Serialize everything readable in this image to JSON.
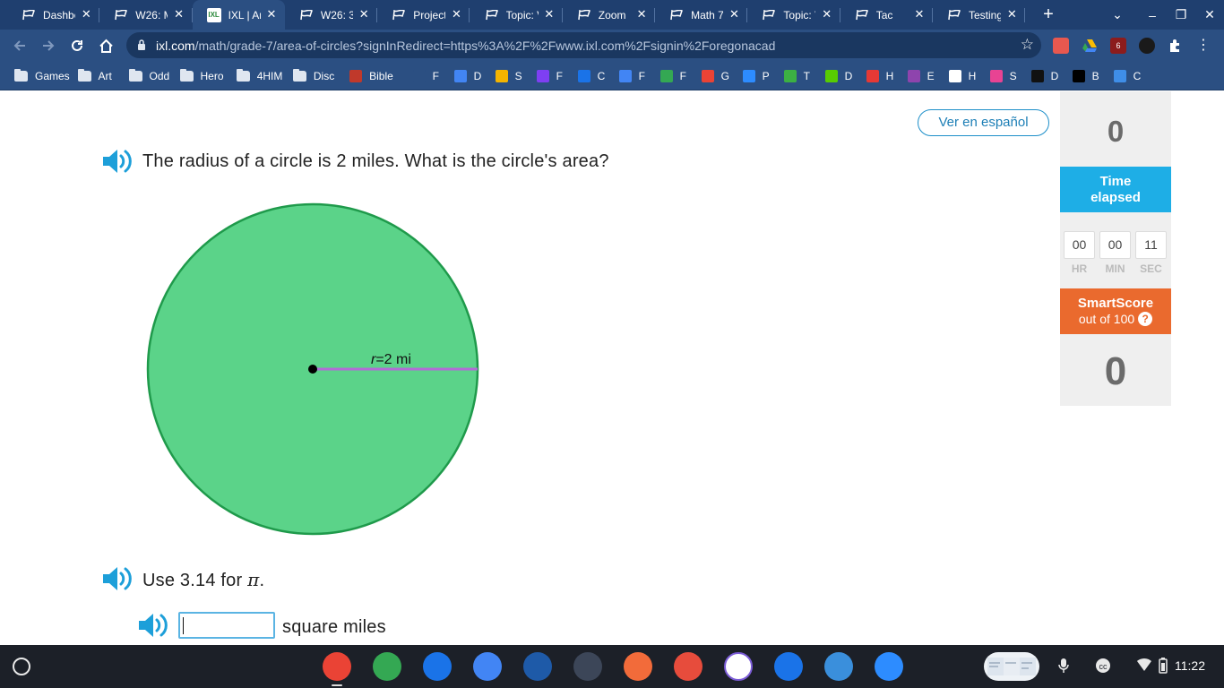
{
  "tabs": [
    {
      "title": "Dashbo",
      "active": false
    },
    {
      "title": "W26: M",
      "active": false
    },
    {
      "title": "IXL | Ar",
      "active": true
    },
    {
      "title": "W26: 3.",
      "active": false
    },
    {
      "title": "Project",
      "active": false
    },
    {
      "title": "Topic: V",
      "active": false
    },
    {
      "title": "Zoom",
      "active": false
    },
    {
      "title": "Math 7",
      "active": false
    },
    {
      "title": "Topic: V",
      "active": false
    },
    {
      "title": "Tac",
      "active": false
    },
    {
      "title": "Testing",
      "active": false
    }
  ],
  "tab_favicon_text": "IXL",
  "new_tab_label": "+",
  "window_controls": {
    "dropdown": "⌄",
    "minimize": "–",
    "restore": "❐",
    "close": "✕"
  },
  "address": {
    "host": "ixl.com",
    "path": "/math/grade-7/area-of-circles?signInRedirect=https%3A%2F%2Fwww.ixl.com%2Fsignin%2Foregonacad"
  },
  "extensions_badge": "6",
  "bookmarks": [
    {
      "label": "Games",
      "type": "folder"
    },
    {
      "label": "Art",
      "type": "folder"
    },
    {
      "label": "Odd",
      "type": "folder"
    },
    {
      "label": "Hero",
      "type": "folder"
    },
    {
      "label": "4HIM",
      "type": "folder"
    },
    {
      "label": "Disc",
      "type": "folder"
    },
    {
      "label": "Bible",
      "type": "link",
      "color": "#c0392b"
    },
    {
      "label": "F",
      "type": "link",
      "color": "#2b4f82",
      "glyph": "✝"
    },
    {
      "label": "D",
      "type": "link",
      "color": "#4285f4"
    },
    {
      "label": "S",
      "type": "link",
      "color": "#f4b400"
    },
    {
      "label": "F",
      "type": "link",
      "color": "#7e3ff2"
    },
    {
      "label": "C",
      "type": "link",
      "color": "#1a73e8"
    },
    {
      "label": "F",
      "type": "link",
      "color": "#4285f4"
    },
    {
      "label": "F",
      "type": "link",
      "color": "#34a853"
    },
    {
      "label": "G",
      "type": "link",
      "color": "#ea4335"
    },
    {
      "label": "P",
      "type": "link",
      "color": "#2d8cff"
    },
    {
      "label": "T",
      "type": "link",
      "color": "#3cb043"
    },
    {
      "label": "D",
      "type": "link",
      "color": "#58cc02"
    },
    {
      "label": "H",
      "type": "link",
      "color": "#e53935"
    },
    {
      "label": "E",
      "type": "link",
      "color": "#8e44ad"
    },
    {
      "label": "H",
      "type": "link",
      "color": "#ffffff"
    },
    {
      "label": "S",
      "type": "link",
      "color": "#e84393"
    },
    {
      "label": "D",
      "type": "link",
      "color": "#111111"
    },
    {
      "label": "B",
      "type": "link",
      "color": "#000000"
    },
    {
      "label": "C",
      "type": "link",
      "color": "#3f8ee8"
    }
  ],
  "page": {
    "spanish_button": "Ver en español",
    "question": "The radius of a circle is 2 miles. What is the circle's area?",
    "figure": {
      "radius_var": "r",
      "radius_value": "=2 mi",
      "fill": "#5bd389",
      "stroke": "#1f9a4b",
      "radius_color": "#b36bd6"
    },
    "pi_hint_prefix": "Use 3.14 for ",
    "pi_symbol": "π",
    "pi_hint_suffix": ".",
    "answer_value": "",
    "answer_unit": "square miles"
  },
  "sidebar": {
    "questions_answered": "0",
    "time_elapsed_label_1": "Time",
    "time_elapsed_label_2": "elapsed",
    "timer": {
      "hr": "00",
      "min": "00",
      "sec": "11"
    },
    "timer_labels": {
      "hr": "HR",
      "min": "MIN",
      "sec": "SEC"
    },
    "smartscore_title": "SmartScore",
    "smartscore_sub": "out of 100",
    "help_glyph": "?",
    "smartscore": "0"
  },
  "shelf": {
    "apps": [
      {
        "name": "chrome",
        "color": "#ea4335"
      },
      {
        "name": "drive",
        "color": "#34a853"
      },
      {
        "name": "camera",
        "color": "#1a73e8"
      },
      {
        "name": "docs",
        "color": "#4285f4"
      },
      {
        "name": "settings-wheel",
        "color": "#1e5aa8"
      },
      {
        "name": "video-editor",
        "color": "#3c4658"
      },
      {
        "name": "pear-deck",
        "color": "#f26b3a"
      },
      {
        "name": "paint",
        "color": "#e74c3c"
      },
      {
        "name": "screen-capture",
        "color": "#ffffff"
      },
      {
        "name": "files",
        "color": "#1a73e8"
      },
      {
        "name": "canvas",
        "color": "#3a8fdc"
      },
      {
        "name": "zoom",
        "color": "#2d8cff"
      }
    ],
    "clock": "11:22"
  }
}
